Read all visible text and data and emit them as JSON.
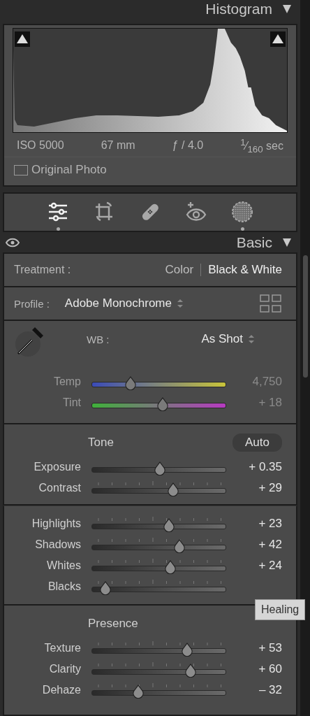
{
  "histogram_header": {
    "title": "Histogram"
  },
  "histogram": {
    "meta": [
      "ISO 5000",
      "67 mm",
      "ƒ / 4.0"
    ],
    "shutter": "$^{1}$⁄$_{160}$ sec",
    "original_photo": {
      "label": "Original Photo",
      "checked": false
    }
  },
  "tools": [
    {
      "kind": "sliders",
      "selected": true,
      "dot": true
    },
    {
      "kind": "crop",
      "selected": false,
      "dot": false
    },
    {
      "kind": "bandage",
      "selected": false,
      "dot": false
    },
    {
      "kind": "eye-plus",
      "selected": false,
      "dot": false
    },
    {
      "kind": "mask",
      "selected": false,
      "dot": true
    }
  ],
  "basic_header": {
    "title": "Basic"
  },
  "treatment": {
    "label": "Treatment :",
    "options": [
      {
        "label": "Color",
        "selected": false
      },
      {
        "label": "Black & White",
        "selected": true
      }
    ]
  },
  "profile": {
    "label": "Profile :",
    "value": "Adobe Monochrome"
  },
  "wb": {
    "label": "WB :",
    "value": "As Shot"
  },
  "wb_sliders": [
    {
      "label": "Temp",
      "kind": "temp",
      "level": 0.3,
      "value": "4,750",
      "disabled": true
    },
    {
      "label": "Tint",
      "kind": "tint",
      "level": 0.55,
      "value": "+ 18",
      "disabled": true
    }
  ],
  "tone": {
    "title": "Tone",
    "auto": "Auto"
  },
  "tone_sliders": [
    {
      "label": "Exposure",
      "kind": "plain",
      "level": 0.53,
      "value": "+ 0.35"
    },
    {
      "label": "Contrast",
      "kind": "ticked",
      "level": 0.63,
      "value": "+ 29"
    }
  ],
  "light_sliders": [
    {
      "label": "Highlights",
      "kind": "ticked",
      "level": 0.6,
      "value": "+ 23"
    },
    {
      "label": "Shadows",
      "kind": "ticked",
      "level": 0.68,
      "value": "+ 42"
    },
    {
      "label": "Whites",
      "kind": "ticked",
      "level": 0.61,
      "value": "+ 24"
    },
    {
      "label": "Blacks",
      "kind": "ticked",
      "level": 0.11
    }
  ],
  "presence": {
    "title": "Presence"
  },
  "presence_sliders": [
    {
      "label": "Texture",
      "kind": "ticked",
      "level": 0.74,
      "value": "+ 53"
    },
    {
      "label": "Clarity",
      "kind": "ticked",
      "level": 0.77,
      "value": "+ 60"
    },
    {
      "label": "Dehaze",
      "kind": "ticked",
      "level": 0.36,
      "value": "– 32"
    }
  ],
  "tooltip": "Healing"
}
